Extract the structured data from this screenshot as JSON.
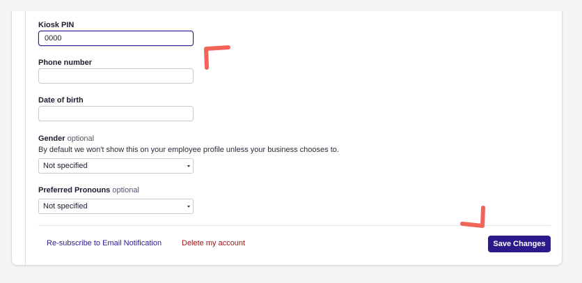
{
  "form": {
    "kiosk_pin": {
      "label": "Kiosk PIN",
      "value": "0000"
    },
    "phone": {
      "label": "Phone number",
      "value": ""
    },
    "dob": {
      "label": "Date of birth",
      "value": ""
    },
    "gender": {
      "label": "Gender",
      "optional": "optional",
      "help": "By default we won't show this on your employee profile unless your business chooses to.",
      "selected": "Not specified"
    },
    "pronouns": {
      "label": "Preferred Pronouns",
      "optional": "optional",
      "selected": "Not specified"
    }
  },
  "footer": {
    "resubscribe": "Re-subscribe to Email Notification",
    "delete": "Delete my account",
    "save": "Save Changes"
  },
  "colors": {
    "accent": "#2c1a8c",
    "danger": "#9b1111",
    "annotation": "#f0645a"
  }
}
